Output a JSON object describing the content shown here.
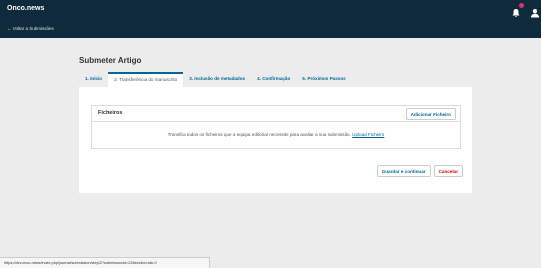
{
  "header": {
    "brand": "Onco.news",
    "back_link": "← Voltar a Submissões",
    "icons": {
      "notifications": "bell-icon",
      "user": "user-icon"
    },
    "colors": {
      "background": "#0f2b3b",
      "badge": "#d9336f"
    }
  },
  "main": {
    "title": "Submeter Artigo",
    "tabs": [
      {
        "label": "1. Início"
      },
      {
        "label": "2. Transferência do manuscrito",
        "active": true
      },
      {
        "label": "3. Inclusão de metadados"
      },
      {
        "label": "4. Confirmação"
      },
      {
        "label": "5. Próximos Passos"
      }
    ],
    "files": {
      "title": "Ficheiros",
      "add_button": "Adicionar Ficheiro",
      "empty_text": "Transfira todos os ficheiros que a equipa editorial necessite para avaliar a sua submissão.",
      "upload_link": "Upload Ficheiro"
    },
    "actions": {
      "save": "Guardar e continuar",
      "cancel": "Cancelar"
    }
  },
  "status_bar": {
    "url": "https://dev.onco.news/index.php/journal/submission/step/2?submissionId=22#section-tab-0"
  },
  "colors": {
    "accent": "#006798",
    "danger": "#d00a0a"
  }
}
